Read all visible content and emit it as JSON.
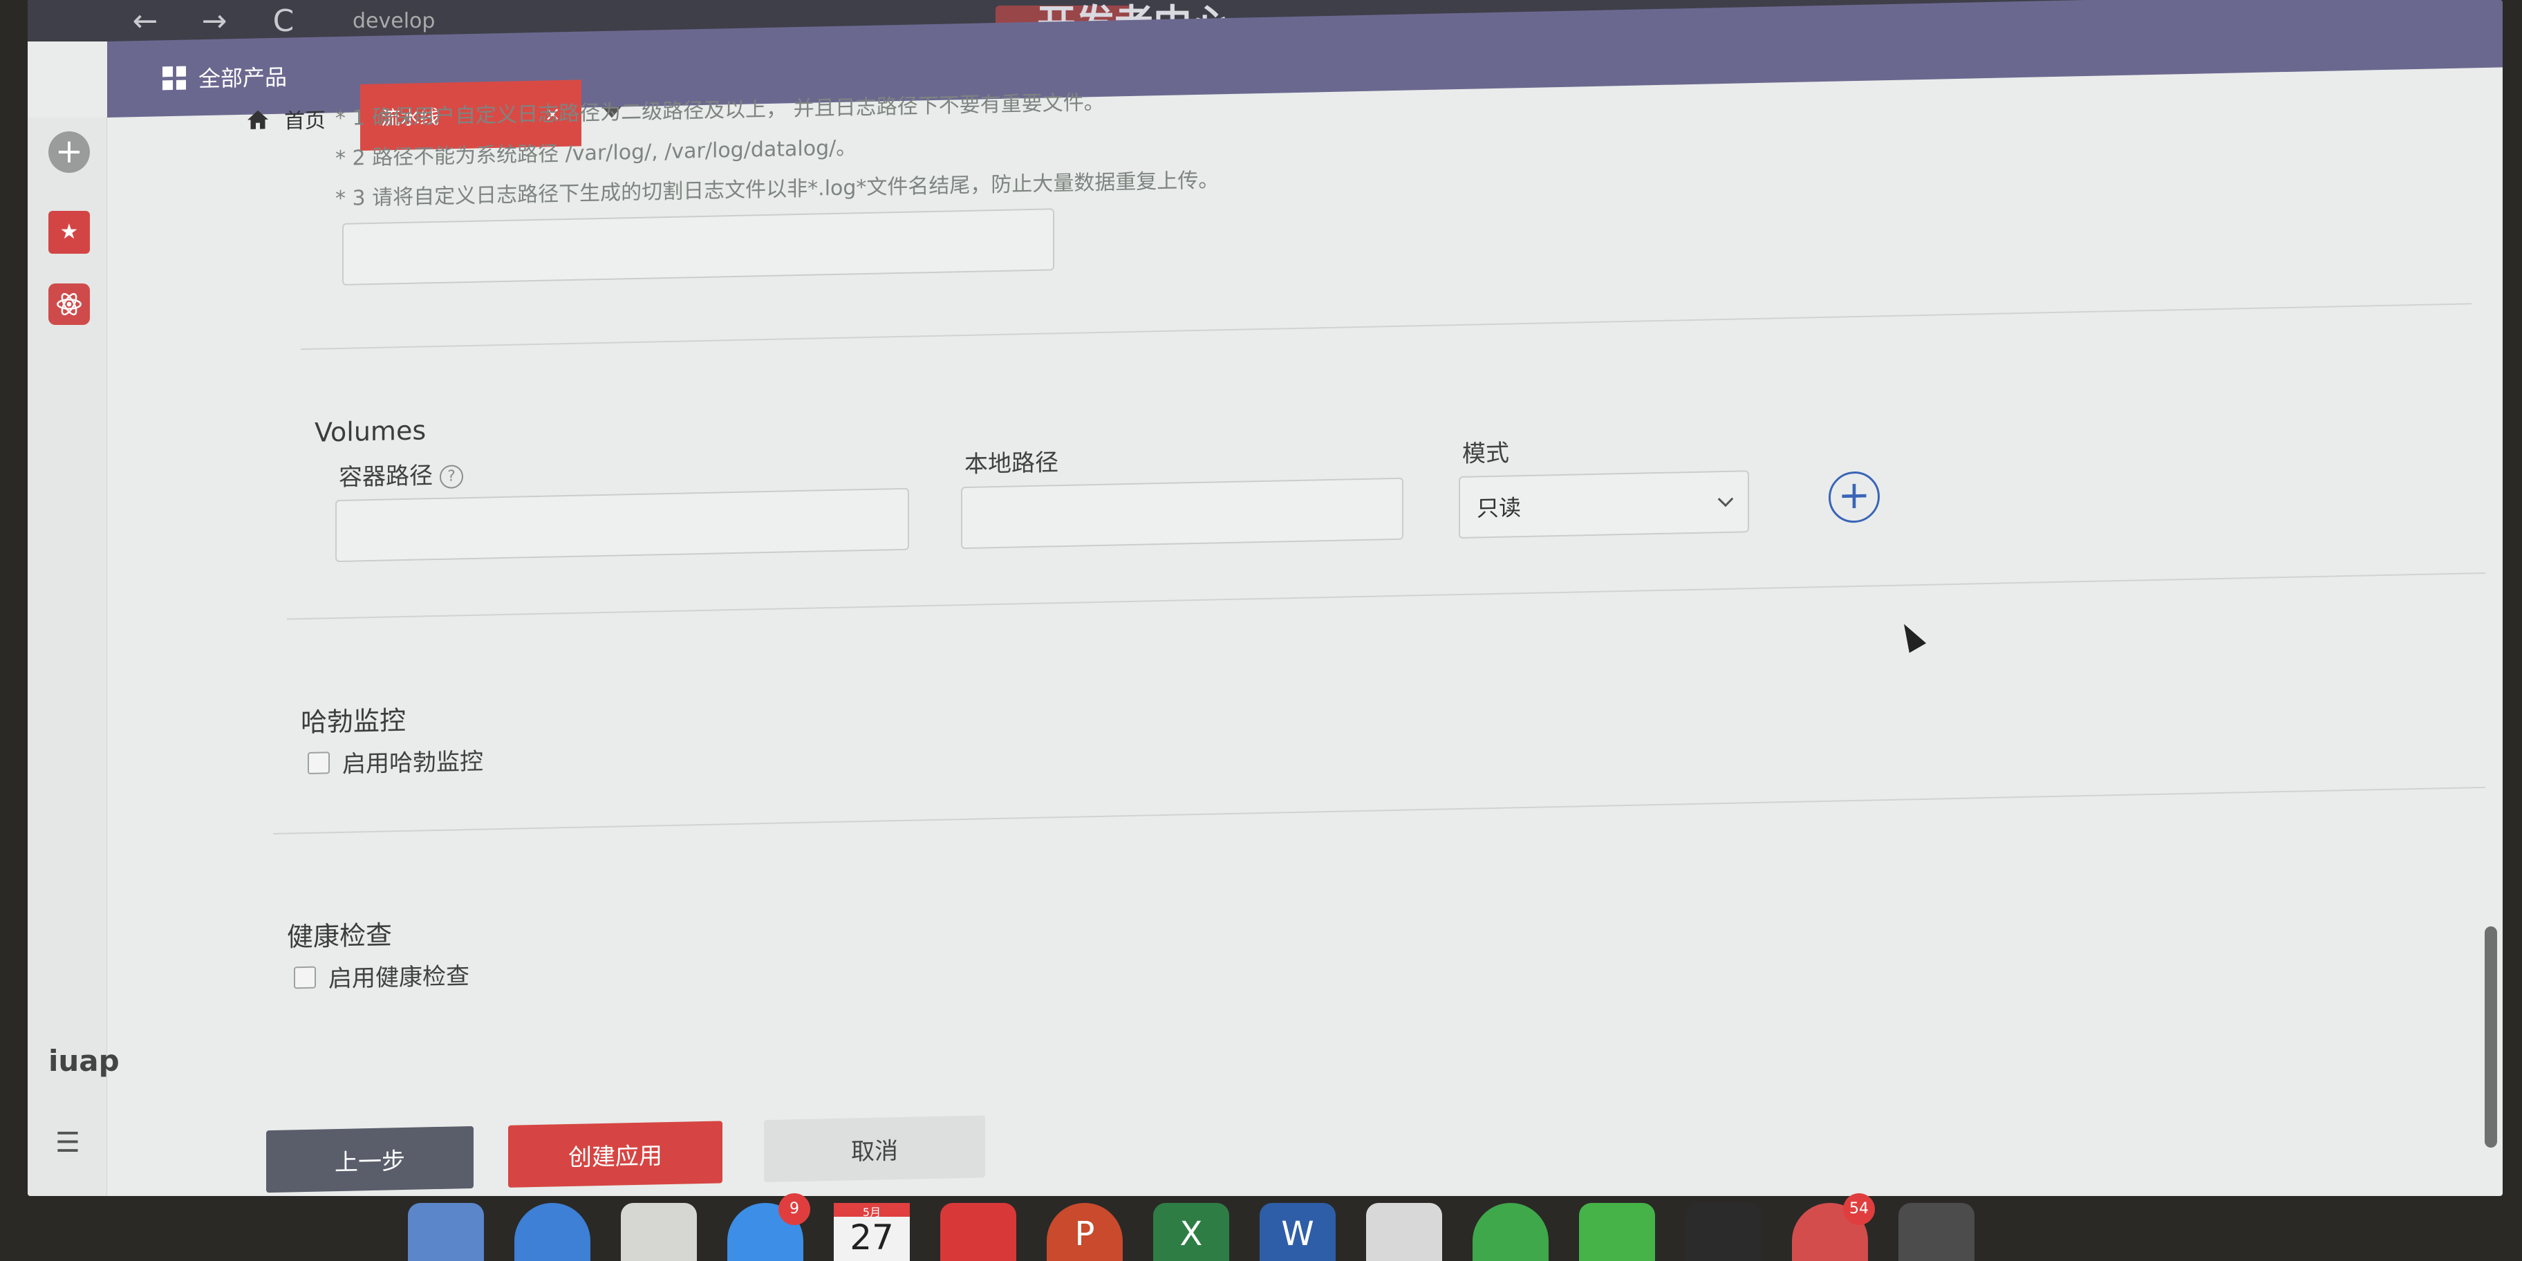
{
  "browser": {
    "back": "←",
    "forward": "→",
    "reload": "C",
    "url": "develop",
    "site_title": "开发者中心"
  },
  "header": {
    "title": "全部产品"
  },
  "tabs": {
    "home_label": "首页",
    "active_label": "流水线",
    "close": "×"
  },
  "sidebar": {
    "add": "+",
    "fav": "★",
    "logo": "iuap",
    "menu": "☰"
  },
  "notes": {
    "line1": "* 1 确保用户自定义日志路径为二级路径及以上，  并且日志路径下不要有重要文件。",
    "line2": "* 2 路径不能为系统路径 /var/log/, /var/log/datalog/。",
    "line3": "* 3 请将自定义日志路径下生成的切割日志文件以非*.log*文件名结尾，防止大量数据重复上传。"
  },
  "volumes": {
    "title": "Volumes",
    "container_path_label": "容器路径",
    "help": "?",
    "local_path_label": "本地路径",
    "mode_label": "模式",
    "mode_value": "只读",
    "add": "+"
  },
  "hubble": {
    "title": "哈勃监控",
    "checkbox_label": "启用哈勃监控"
  },
  "health": {
    "title": "健康检查",
    "checkbox_label": "启用健康检查"
  },
  "buttons": {
    "prev": "上一步",
    "create": "创建应用",
    "cancel": "取消"
  },
  "dock": {
    "appstore_badge": "9",
    "calendar_day": "27",
    "calendar_month": "5月",
    "ppt": "P",
    "excel": "X",
    "word": "W",
    "cloud_badge": "54"
  }
}
